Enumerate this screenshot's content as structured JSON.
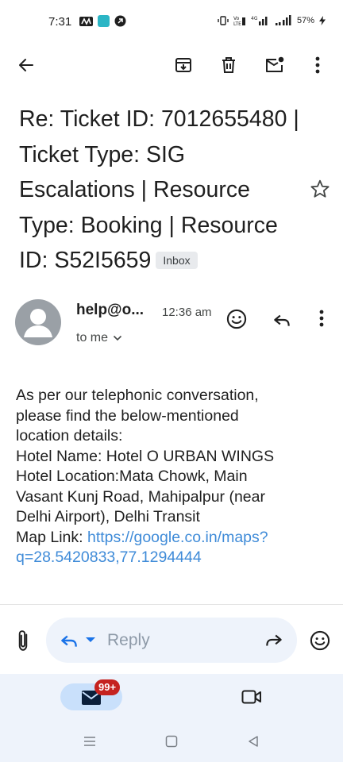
{
  "status_bar": {
    "time": "7:31",
    "battery": "57%",
    "network_label": "4G"
  },
  "toolbar": {
    "back_icon": "arrow-back-icon",
    "archive_icon": "archive-icon",
    "delete_icon": "trash-icon",
    "mark_unread_icon": "mail-unread-icon",
    "more_icon": "more-vert-icon"
  },
  "email": {
    "subject": "Re: Ticket ID: 7012655480 | Ticket Type: SIG Escalations | Resource Type: Booking | Resource ID: S52I5659",
    "label": "Inbox",
    "sender": "help@o...",
    "time": "12:36 am",
    "recipient": "to me",
    "body_lines": [
      "As per our telephonic conversation,",
      "please find the below-mentioned",
      "location details:",
      "Hotel Name: Hotel O URBAN WINGS",
      "Hotel Location:Mata Chowk, Main",
      "Vasant Kunj Road, Mahipalpur (near",
      "Delhi Airport), Delhi Transit"
    ],
    "map_label": "Map Link: ",
    "map_url_line1": "https://google.co.in/maps?",
    "map_url_line2": "q=28.5420833,77.1294444"
  },
  "reply_bar": {
    "placeholder": "Reply"
  },
  "bottom_nav": {
    "unread_badge": "99+"
  },
  "colors": {
    "accent": "#1a73e8",
    "link": "#3f8bd8",
    "badge": "#c5221f",
    "pill_bg": "#eef3fb",
    "avatar": "#9aa0a6"
  }
}
